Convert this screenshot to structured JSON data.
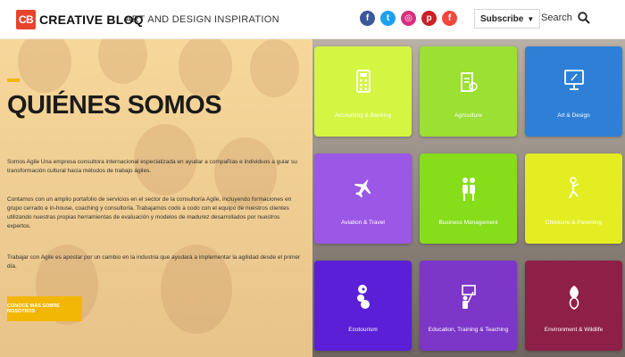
{
  "header": {
    "logo_badge": "CB",
    "logo_text": "CREATIVE BLOQ",
    "tagline": "ART AND DESIGN INSPIRATION",
    "social": [
      "f",
      "t",
      "◎",
      "p",
      "f"
    ],
    "subscribe_label": "Subscribe",
    "subscribe_caret": "▼",
    "search_label": "Search"
  },
  "hero": {
    "title": "QUIÉNES SOMOS",
    "paragraphs": [
      "Somos Agile Una empresa consultora internacional especializada en ayudar a compañías e individuos a guiar su transformación cultural hacia métodos de trabajo ágiles.",
      "Contamos con un amplio portafolio de servicios en el sector de la consultoría Agile, incluyendo formaciones en grupo cerrado e in-house, coaching y consultoría. Trabajamos codo a codo con el equipo de nuestros clientes utilizando nuestras propias herramientas de evaluación y modelos de madurez desarrollados por nuestros expertos.",
      "Trabajar con Agile es apostar por un cambio en la industria que ayudará a implementar la agilidad desde el primer día."
    ],
    "cta_label": "CONOCE MÁS SOBRE NOSOTROS"
  },
  "tiles": [
    {
      "label": "Accounting & Banking",
      "icon": "calculator-icon",
      "color": "#d4f542"
    },
    {
      "label": "Agriculture",
      "icon": "agriculture-icon",
      "color": "#9be033"
    },
    {
      "label": "Art & Design",
      "icon": "monitor-icon",
      "color": "#2f7fd6"
    },
    {
      "label": "Aviation & Travel",
      "icon": "airplane-icon",
      "color": "#9b57e6"
    },
    {
      "label": "Business Management",
      "icon": "business-icon",
      "color": "#86dd1a"
    },
    {
      "label": "Childcare & Parenting",
      "icon": "childcare-icon",
      "color": "#e3ed22"
    },
    {
      "label": "Ecotourism",
      "icon": "ecotourism-icon",
      "color": "#5a1fd6"
    },
    {
      "label": "Education, Training & Teaching",
      "icon": "education-icon",
      "color": "#7c36c8"
    },
    {
      "label": "Environment & Wildlife",
      "icon": "environment-icon",
      "color": "#8e2048"
    }
  ]
}
